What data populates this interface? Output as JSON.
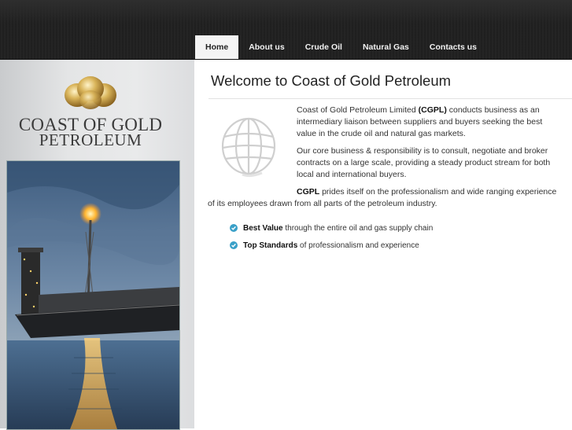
{
  "nav": {
    "items": [
      {
        "label": "Home",
        "active": true
      },
      {
        "label": "About us",
        "active": false
      },
      {
        "label": "Crude Oil",
        "active": false
      },
      {
        "label": "Natural Gas",
        "active": false
      },
      {
        "label": "Contacts us",
        "active": false
      }
    ]
  },
  "logo": {
    "line1": "COAST OF GOLD",
    "line2": "PETROLEUM",
    "icon": "gold-nuggets-icon"
  },
  "main": {
    "title": "Welcome to Coast of Gold Petroleum",
    "globe_icon": "globe-icon",
    "p1_prefix": "Coast of Gold Petroleum Limited ",
    "p1_bold": "(CGPL)",
    "p1_suffix": " conducts business as an intermediary liaison between suppliers and buyers seeking the best value in the crude oil and natural gas markets.",
    "p2": "Our core business & responsibility is to consult, negotiate and broker contracts on a large scale, providing a steady product stream for both local and international buyers.",
    "p3_bold": "CGPL",
    "p3_rest": " prides itself on the professionalism and wide ranging experience of its employees drawn from all parts of the petroleum industry.",
    "bullets": [
      {
        "bold": "Best Value",
        "text": " through the entire oil and gas supply chain"
      },
      {
        "bold": "Top Standards",
        "text": " of professionalism and experience"
      }
    ]
  },
  "colors": {
    "topbar": "#1f1f1f",
    "check_bullet": "#3aa0c8"
  }
}
